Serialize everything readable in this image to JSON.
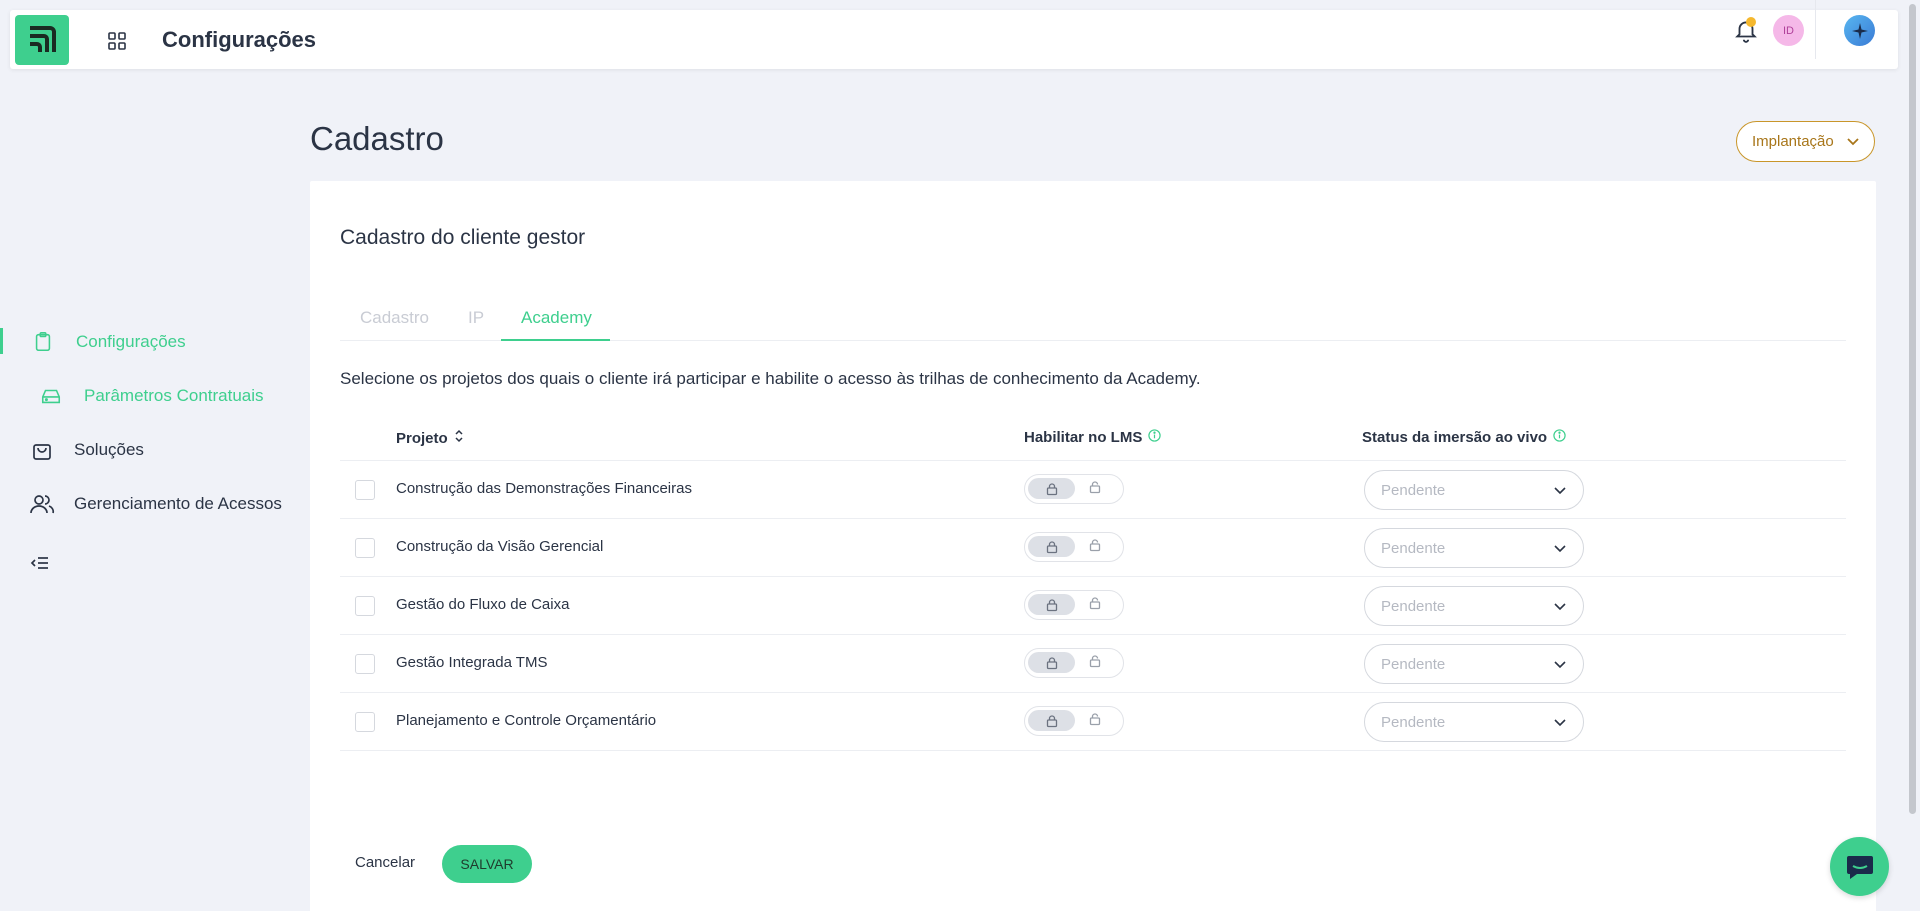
{
  "header": {
    "title": "Configurações",
    "avatar_initials": "ID",
    "icons": [
      "apps-grid-icon",
      "bell-icon",
      "ai-sparkle-icon"
    ]
  },
  "sidebar": {
    "items": [
      {
        "label": "Configurações",
        "icon": "clipboard-icon",
        "active": true
      },
      {
        "label": "Parâmetros Contratuais",
        "icon": "drive-icon",
        "active": true
      },
      {
        "label": "Soluções",
        "icon": "shopping-bag-icon",
        "active": false
      },
      {
        "label": "Gerenciamento de Acessos",
        "icon": "users-icon",
        "active": false
      }
    ],
    "collapse_icon": "collapse-menu-icon"
  },
  "page": {
    "title": "Cadastro",
    "phase_select": "Implantação"
  },
  "card": {
    "title": "Cadastro do cliente gestor",
    "tabs": [
      {
        "label": "Cadastro",
        "active": false
      },
      {
        "label": "IP",
        "active": false
      },
      {
        "label": "Academy",
        "active": true
      }
    ],
    "description": "Selecione os projetos dos quais o cliente irá participar e habilite o acesso às trilhas de conhecimento da Academy.",
    "columns": {
      "project": "Projeto",
      "lms": "Habilitar no LMS",
      "status": "Status da imersão ao vivo"
    },
    "rows": [
      {
        "project": "Construção das Demonstrações Financeiras",
        "checked": false,
        "lms_enabled": false,
        "status": "Pendente"
      },
      {
        "project": "Construção da Visão Gerencial",
        "checked": false,
        "lms_enabled": false,
        "status": "Pendente"
      },
      {
        "project": "Gestão do Fluxo de Caixa",
        "checked": false,
        "lms_enabled": false,
        "status": "Pendente"
      },
      {
        "project": "Gestão Integrada TMS",
        "checked": false,
        "lms_enabled": false,
        "status": "Pendente"
      },
      {
        "project": "Planejamento e Controle Orçamentário",
        "checked": false,
        "lms_enabled": false,
        "status": "Pendente"
      }
    ],
    "cancel_label": "Cancelar",
    "save_label": "SALVAR"
  },
  "colors": {
    "accent": "#3ecf8e",
    "phase_border": "#c9962a",
    "background": "#f0f2f8"
  }
}
